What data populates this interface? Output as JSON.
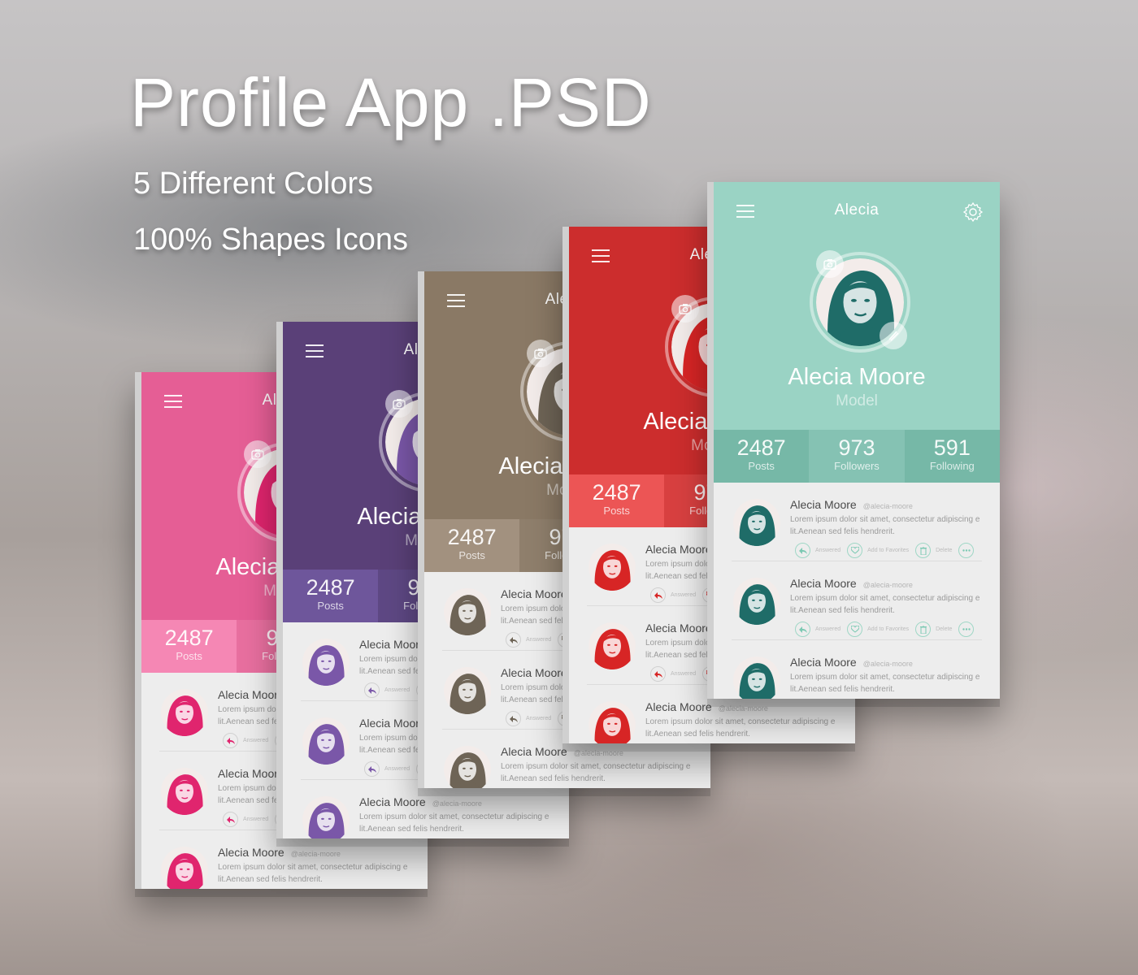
{
  "heading": {
    "title": "Profile App .PSD",
    "subtitle_1": "5 Different Colors",
    "subtitle_2": "100% Shapes Icons"
  },
  "cards": [
    {
      "theme": "pink",
      "header_color": "#e55e95",
      "stats_color": "#f587b4",
      "stats_divider": "#e86f9f",
      "avatar_tint": "#e0256e"
    },
    {
      "theme": "purple",
      "header_color": "#5a4078",
      "stats_color": "#6e569b",
      "stats_divider": "#5e4884",
      "avatar_tint": "#7a57a8"
    },
    {
      "theme": "taupe",
      "header_color": "#8a7965",
      "stats_color": "#a2917f",
      "stats_divider": "#8f7f6c",
      "avatar_tint": "#6e6456"
    },
    {
      "theme": "red",
      "header_color": "#cc2d2d",
      "stats_color": "#ec5555",
      "stats_divider": "#d84040",
      "avatar_tint": "#d72525"
    },
    {
      "theme": "mint",
      "header_color": "#9ad3c4",
      "stats_color": "#76b8a7",
      "stats_divider": "#85c2b3",
      "avatar_tint": "#1f6c68"
    }
  ],
  "profile": {
    "header_title": "Alecia",
    "name": "Alecia Moore",
    "role": "Model"
  },
  "stats": [
    {
      "value": "2487",
      "label": "Posts"
    },
    {
      "value": "973",
      "label": "Followers"
    },
    {
      "value": "591",
      "label": "Following"
    }
  ],
  "feed": {
    "items": [
      {
        "name": "Alecia Moore",
        "handle": "@alecia-moore",
        "text_line_1": "Lorem ipsum dolor sit amet, consectetur adipiscing e",
        "text_line_2": "lit.Aenean sed felis hendrerit.",
        "has_actions": true
      },
      {
        "name": "Alecia Moore",
        "handle": "@alecia-moore",
        "text_line_1": "Lorem ipsum dolor sit amet, consectetur adipiscing e",
        "text_line_2": "lit.Aenean sed felis hendrerit.",
        "has_actions": true
      },
      {
        "name": "Alecia Moore",
        "handle": "@alecia-moore",
        "text_line_1": "Lorem ipsum dolor sit amet, consectetur adipiscing e",
        "text_line_2": "lit.Aenean sed felis hendrerit.",
        "has_actions": false
      }
    ],
    "actions": [
      {
        "label": "Answered",
        "icon": "reply-icon"
      },
      {
        "label": "Add to Favorites",
        "icon": "heart-icon"
      },
      {
        "label": "Delete",
        "icon": "trash-icon"
      },
      {
        "label": "",
        "icon": "more-icon"
      }
    ]
  }
}
